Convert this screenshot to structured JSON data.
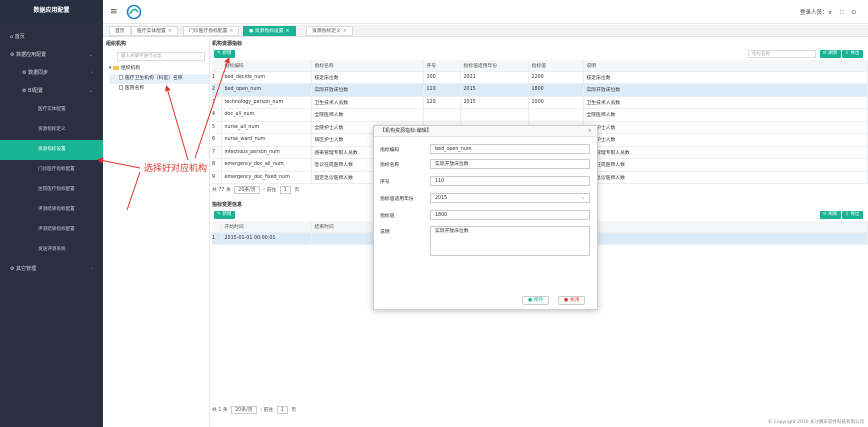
{
  "app": {
    "title": "数据应用配置",
    "user_label": "登录人员：",
    "user_name": "ir"
  },
  "sidebar": {
    "home": "首页",
    "data_app": "数据应用配置",
    "data_sync": "数据同步",
    "bi_config": "BI配置",
    "items": [
      "医疗实体配置",
      "资源指标定义",
      "资源指标设置",
      "门诊医疗指标配置",
      "住院医疗指标配置",
      "评测结果指标配置",
      "评测结果指标配置",
      "发送评测系统"
    ],
    "other": "其它管理"
  },
  "tabs": [
    {
      "label": "首页"
    },
    {
      "label": "医疗实体配置"
    },
    {
      "label": "门诊医疗指标配置"
    },
    {
      "label": "资源指标设置"
    },
    {
      "label": "资源指标定义"
    }
  ],
  "org": {
    "title": "组织机构",
    "search_placeholder": "输入关键字进行过滤",
    "root": "组织机构",
    "selected": "医疗卫生机构（科室）名称",
    "other": "医院名称"
  },
  "resource": {
    "title": "机构资源指标",
    "add": "新增",
    "search_placeholder": "指标名称",
    "refresh": "刷新",
    "export": "导出",
    "columns": [
      "指标编码",
      "指标名称",
      "序号",
      "指标值适用年份",
      "指标值",
      "说明"
    ],
    "rows": [
      {
        "i": "1",
        "code": "bed_decide_num",
        "name": "核定床位数",
        "seq": "100",
        "year": "2021",
        "val": "2200",
        "desc": "核定床位数"
      },
      {
        "i": "2",
        "code": "bed_open_num",
        "name": "实际开放床位数",
        "seq": "110",
        "year": "2015",
        "val": "1800",
        "desc": "实际开放床位数"
      },
      {
        "i": "3",
        "code": "technology_person_num",
        "name": "卫生技术人员数",
        "seq": "120",
        "year": "2015",
        "val": "1000",
        "desc": "卫生技术人员数"
      },
      {
        "i": "4",
        "code": "doc_all_num",
        "name": "全院医师人数",
        "seq": "",
        "year": "",
        "val": "",
        "desc": "全院医师人数"
      },
      {
        "i": "5",
        "code": "nurse_all_num",
        "name": "全院护士人数",
        "seq": "",
        "year": "",
        "val": "",
        "desc": "全院护士人数"
      },
      {
        "i": "6",
        "code": "nurse_ward_num",
        "name": "病区护士人数",
        "seq": "",
        "year": "",
        "val": "",
        "desc": "病区护士人数"
      },
      {
        "i": "7",
        "code": "infectious_person_num",
        "name": "感染管理专职人员数",
        "seq": "",
        "year": "",
        "val": "",
        "desc": "感染管理专职人员数"
      },
      {
        "i": "8",
        "code": "emergency_doc_all_num",
        "name": "急诊在岗医师人数",
        "seq": "",
        "year": "",
        "val": "",
        "desc": "急诊在岗医师人数"
      },
      {
        "i": "9",
        "code": "emergency_doc_fixed_num",
        "name": "固定急诊医师人数",
        "seq": "",
        "year": "",
        "val": "",
        "desc": "固定急诊医师人数"
      }
    ],
    "pager": {
      "total": "共 77 条",
      "size": "20条/页",
      "prev": "前往",
      "page": "1",
      "suffix": "页"
    }
  },
  "change": {
    "title": "指标变更信息",
    "add": "新增",
    "refresh": "刷新",
    "export": "导出",
    "columns": [
      "开始时间",
      "结束时间"
    ],
    "rows": [
      {
        "i": "1",
        "start": "2015-01-01 00:00:01",
        "end": ""
      }
    ],
    "pager": {
      "total": "共 1 条",
      "size": "20条/页",
      "prev": "前往",
      "page": "1",
      "suffix": "页"
    }
  },
  "modal": {
    "title": "【机构资源指标:编辑】",
    "fields": [
      {
        "label": "指标编码",
        "value": "bed_open_num"
      },
      {
        "label": "指标名称",
        "value": "实际开放床位数"
      },
      {
        "label": "序号",
        "value": "110"
      },
      {
        "label": "指标值适用年份",
        "value": "2015"
      },
      {
        "label": "指标值",
        "value": "1800"
      },
      {
        "label": "说明",
        "value": "实际开放床位数"
      }
    ],
    "save": "保存",
    "close": "关闭"
  },
  "annotation": "选择好对应机构",
  "copyright": "© Copyright 2016 长沙赛乐软件科技有限公司"
}
